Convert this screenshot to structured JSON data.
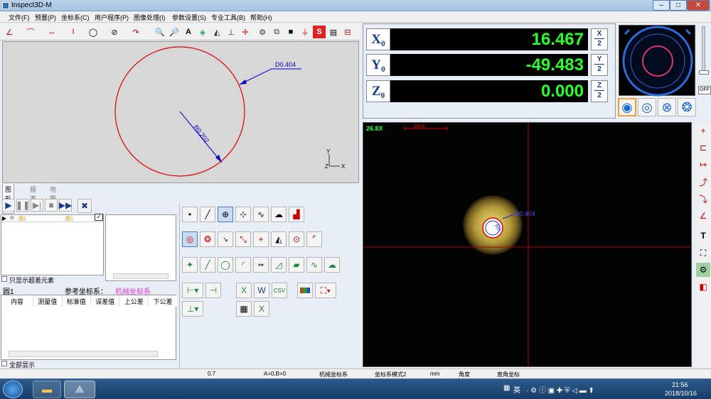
{
  "window": {
    "title": "Inspect3D-M"
  },
  "menu": [
    "文件(F)",
    "预置(P)",
    "坐标系(C)",
    "用户程序(P)",
    "图像处理(I)",
    "参数设置(S)",
    "专业工具(B)",
    "帮助(H)"
  ],
  "toolbar": {
    "text_tool": "A",
    "stop_tool": "S"
  },
  "canvas": {
    "diameter_label": "D0.404",
    "radius_label": "R0.202",
    "axis_y": "Y",
    "axis_x": "X",
    "axis_z": "Z"
  },
  "tabs": [
    "图形区",
    "报表",
    "地图"
  ],
  "program": {
    "item_label": "圆1",
    "item_label2": "圆1",
    "item_count": "1",
    "show_out_of_tol": "只显示超差元素"
  },
  "report": {
    "element": "圆1",
    "ref_label": "参考坐标系：",
    "ref_value": "机械坐标系",
    "columns": [
      "内容",
      "测量值",
      "标准值",
      "误差值",
      "上公差",
      "下公差"
    ],
    "show_all": "全部显示"
  },
  "dro": {
    "x_label": "X₀",
    "y_label": "Y₀",
    "z_label": "Z₀",
    "x_value": "16.467",
    "y_value": "-49.483",
    "z_value": "0.000",
    "x_half_top": "X",
    "x_half_bot": "2",
    "y_half_top": "Y",
    "y_half_bot": "2",
    "z_half_top": "Z",
    "z_half_bot": "2"
  },
  "light": {
    "off_label": "OFF"
  },
  "camera": {
    "zoom": "26.8X",
    "scale": "1mm",
    "d_label": "D0.404",
    "r_label": "R0"
  },
  "right_tools": {
    "text_tool": "T"
  },
  "status": {
    "v1": "0.7",
    "v2": "A=0,B=0",
    "v3": "机械坐标系",
    "v4": "坐标系模式2",
    "v5": "mm",
    "v6": "角度",
    "v7": "直角坐标"
  },
  "taskbar": {
    "ime": "英",
    "time": "21:56",
    "date": "2018/10/16"
  },
  "colors": {
    "dro_value": "#28ff28",
    "accent": "#1a3c8c",
    "measure_red": "#e00000",
    "measure_blue": "#0000cc"
  }
}
